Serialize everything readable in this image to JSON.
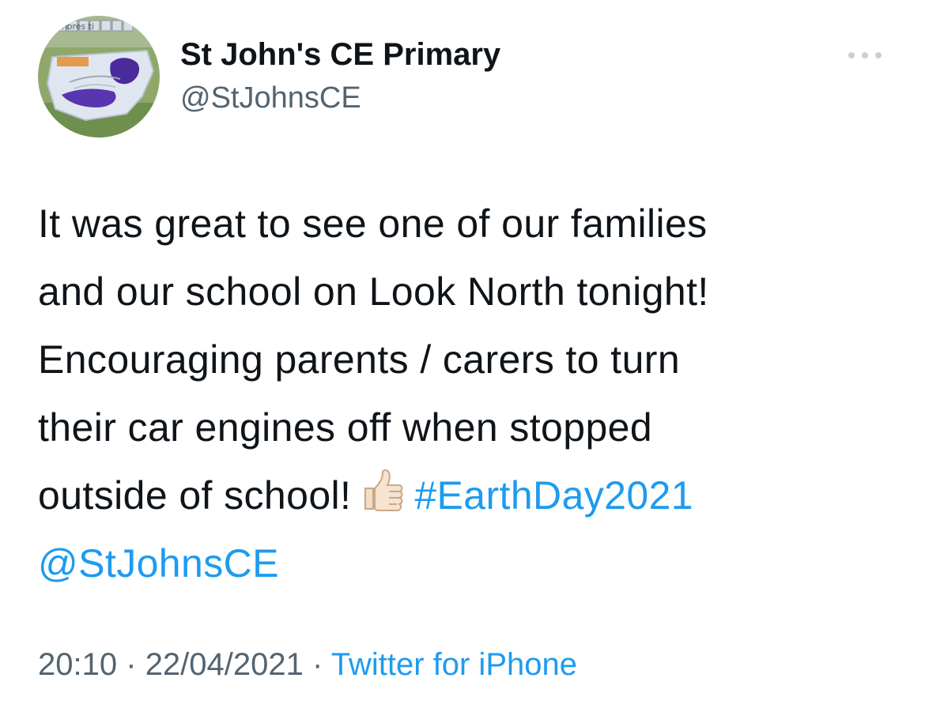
{
  "author": {
    "display_name": "St John's CE Primary",
    "handle": "@StJohnsCE",
    "avatar_caption": "mores ti"
  },
  "tweet": {
    "lines": [
      "It was great to see one of our families",
      "and our school on Look North tonight!",
      "Encouraging parents / carers to turn",
      "their car engines off when stopped"
    ],
    "line5_text": "outside of school!",
    "emoji": "thumbs-up-icon",
    "hashtag": "#EarthDay2021",
    "mention": "@StJohnsCE"
  },
  "meta": {
    "time": "20:10",
    "separator": "·",
    "date": "22/04/2021",
    "source": "Twitter for iPhone"
  },
  "colors": {
    "link": "#1d9bf0",
    "secondary_text": "#536471",
    "primary_text": "#0f1419"
  }
}
